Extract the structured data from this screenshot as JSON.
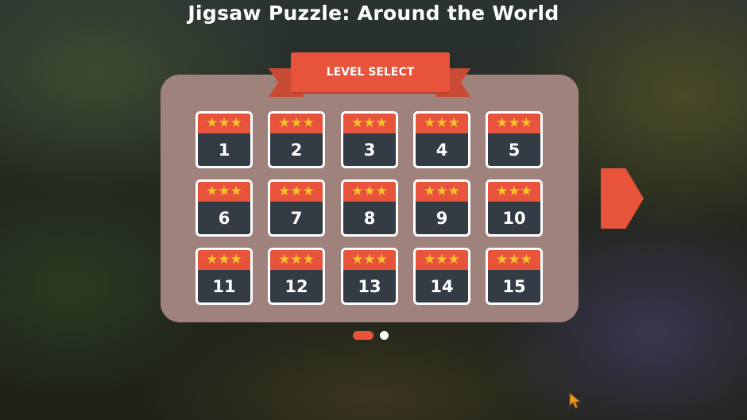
{
  "game": {
    "title": "Jigsaw Puzzle: Around the World"
  },
  "level_select": {
    "heading": "LEVEL SELECT",
    "star_glyph": "★★★",
    "levels": [
      {
        "number": "1",
        "stars": 3
      },
      {
        "number": "2",
        "stars": 3
      },
      {
        "number": "3",
        "stars": 3
      },
      {
        "number": "4",
        "stars": 3
      },
      {
        "number": "5",
        "stars": 3
      },
      {
        "number": "6",
        "stars": 3
      },
      {
        "number": "7",
        "stars": 3
      },
      {
        "number": "8",
        "stars": 3
      },
      {
        "number": "9",
        "stars": 3
      },
      {
        "number": "10",
        "stars": 3
      },
      {
        "number": "11",
        "stars": 3
      },
      {
        "number": "12",
        "stars": 3
      },
      {
        "number": "13",
        "stars": 3
      },
      {
        "number": "14",
        "stars": 3
      },
      {
        "number": "15",
        "stars": 3
      }
    ]
  },
  "pagination": {
    "pages": 2,
    "current_page": 1
  },
  "icons": {
    "next": "next-page-arrow-icon",
    "cursor": "mouse-cursor-icon",
    "star": "star-icon"
  },
  "colors": {
    "accent": "#e8533b",
    "panel": "#a0827c",
    "tile": "#333b45",
    "star": "#f6c32c"
  }
}
